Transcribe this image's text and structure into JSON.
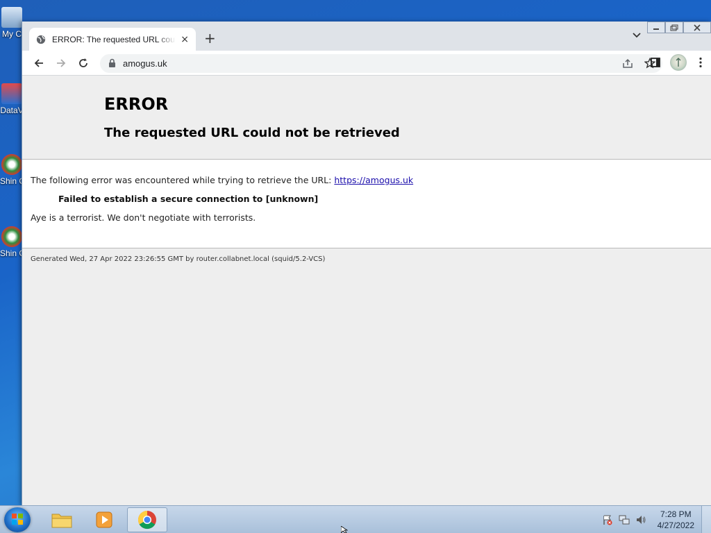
{
  "desktop": {
    "icons": [
      {
        "label": "My C"
      },
      {
        "label": "DataV"
      },
      {
        "label": "Shin Ch"
      },
      {
        "label": "Shin Ch"
      }
    ]
  },
  "browser": {
    "tab": {
      "title": "ERROR: The requested URL could not be retrieved",
      "close": "×"
    },
    "new_tab": "+",
    "address": "amogus.uk"
  },
  "page": {
    "title": "ERROR",
    "subtitle": "The requested URL could not be retrieved",
    "message_prefix": "The following error was encountered while trying to retrieve the URL: ",
    "message_link": "https://amogus.uk",
    "error_detail": "Failed to establish a secure connection to [unknown]",
    "note": "Aye is a terrorist. We don't negotiate with terrorists.",
    "footer": "Generated Wed, 27 Apr 2022 23:26:55 GMT by router.collabnet.local (squid/5.2-VCS)"
  },
  "taskbar": {
    "time": "7:28 PM",
    "date": "4/27/2022",
    "apps": [
      "explorer",
      "media-player",
      "chrome"
    ]
  },
  "colors": {
    "link": "#1a0dab",
    "desktop_blue": "#1a64c8"
  }
}
